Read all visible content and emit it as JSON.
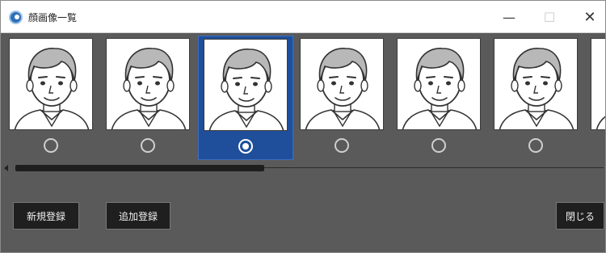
{
  "window": {
    "title": "顔画像一覧",
    "minimize_label": "—",
    "maximize_label": "☐",
    "close_label": "✕"
  },
  "thumbnails": [
    {
      "selected": false
    },
    {
      "selected": false
    },
    {
      "selected": true
    },
    {
      "selected": false
    },
    {
      "selected": false
    },
    {
      "selected": false
    },
    {
      "selected": false
    }
  ],
  "scrollbar": {
    "visible_fraction": 0.42,
    "position_fraction": 0.0
  },
  "buttons": {
    "new_register": "新規登録",
    "add_register": "追加登録",
    "close": "閉じる"
  },
  "colors": {
    "background": "#5a5a5a",
    "selection": "#1f4f9b",
    "button": "#1f1f1f"
  },
  "icons": {
    "app": "app-globe-icon",
    "thumbnail": "face-portrait-icon"
  }
}
